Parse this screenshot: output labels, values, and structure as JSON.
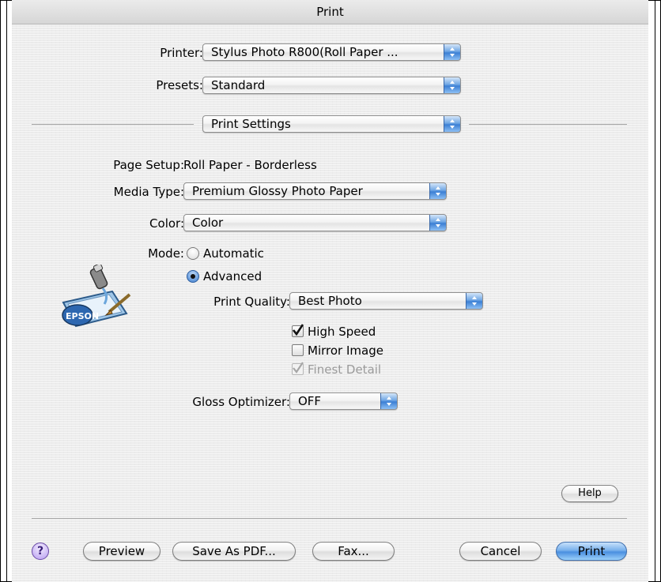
{
  "window": {
    "title": "Print"
  },
  "printer": {
    "label": "Printer:",
    "value": "Stylus Photo R800(Roll Paper ..."
  },
  "presets": {
    "label": "Presets:",
    "value": "Standard"
  },
  "panel": {
    "value": "Print Settings"
  },
  "page_setup": {
    "label": "Page Setup:",
    "value": "Roll Paper - Borderless"
  },
  "media_type": {
    "label": "Media Type:",
    "value": "Premium Glossy Photo Paper"
  },
  "color": {
    "label": "Color:",
    "value": "Color"
  },
  "mode": {
    "label": "Mode:",
    "options": [
      {
        "label": "Automatic",
        "selected": false
      },
      {
        "label": "Advanced",
        "selected": true
      }
    ]
  },
  "logo": {
    "text": "EPSON"
  },
  "print_quality": {
    "label": "Print Quality:",
    "value": "Best Photo"
  },
  "checkboxes": [
    {
      "label": "High Speed",
      "checked": true,
      "enabled": true
    },
    {
      "label": "Mirror Image",
      "checked": false,
      "enabled": true
    },
    {
      "label": "Finest Detail",
      "checked": true,
      "enabled": false
    }
  ],
  "gloss_optimizer": {
    "label": "Gloss Optimizer:",
    "value": "OFF"
  },
  "buttons": {
    "help": "Help",
    "help_icon": "?",
    "preview": "Preview",
    "save_pdf": "Save As PDF...",
    "fax": "Fax...",
    "cancel": "Cancel",
    "print": "Print"
  },
  "colors": {
    "accent": "#3b7fd4",
    "window_bg": "#ececec"
  }
}
